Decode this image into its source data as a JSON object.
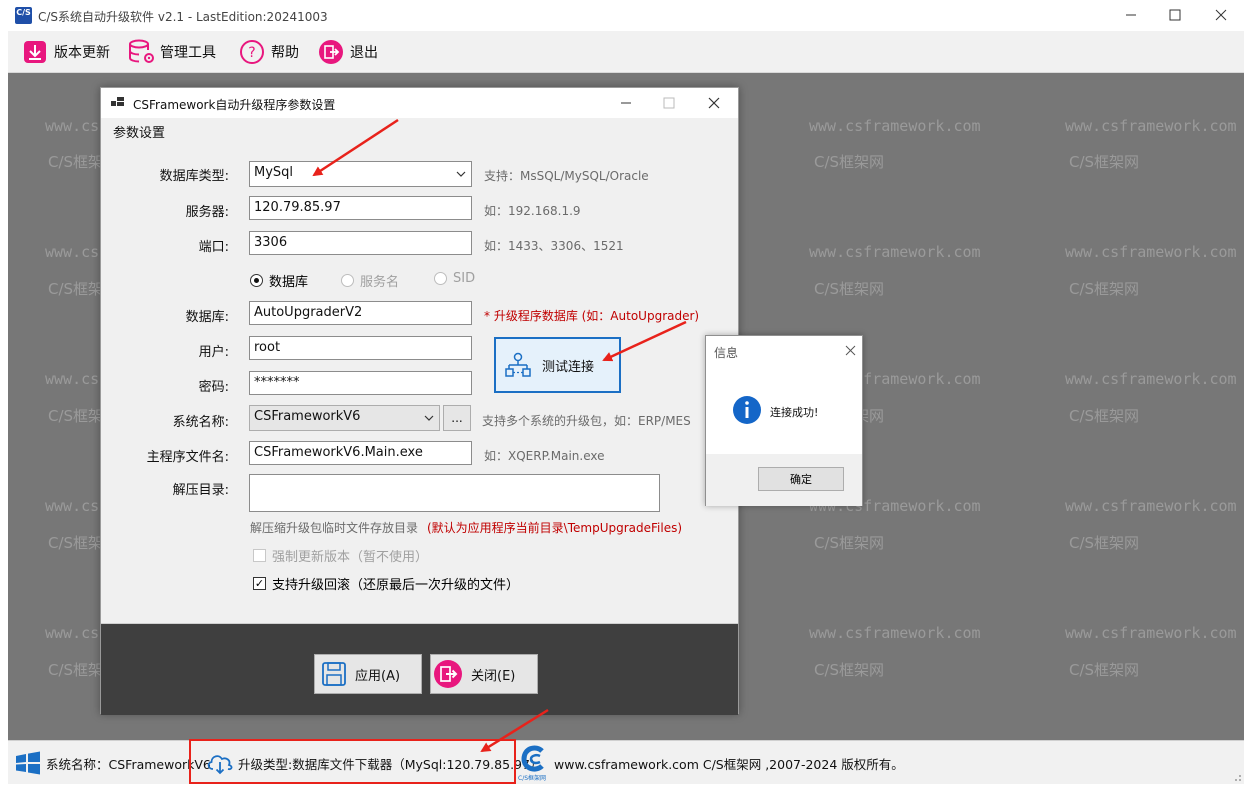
{
  "window": {
    "logo": "C/S",
    "title": "C/S系统自动升级软件 v2.1 - LastEdition:20241003"
  },
  "toolbar": {
    "items": [
      {
        "label": "版本更新",
        "icon": "download-box-icon"
      },
      {
        "label": "管理工具",
        "icon": "database-gear-icon"
      },
      {
        "label": "帮助",
        "icon": "help-circle-icon"
      },
      {
        "label": "退出",
        "icon": "exit-icon"
      }
    ]
  },
  "watermark": {
    "site": "www.csframework.com",
    "brand": "C/S框架网"
  },
  "dialog": {
    "title": "CSFramework自动升级程序参数设置",
    "group_title": "参数设置",
    "labels": {
      "db_type": "数据库类型:",
      "server": "服务器:",
      "port": "端口:",
      "database": "数据库:",
      "user": "用户:",
      "password": "密码:",
      "system_name": "系统名称:",
      "main_exe": "主程序文件名:",
      "extract_dir": "解压目录:"
    },
    "values": {
      "db_type": "MySql",
      "server": "120.79.85.97",
      "port": "3306",
      "database": "AutoUpgraderV2",
      "user": "root",
      "password": "*******",
      "system_name": "CSFrameworkV6",
      "main_exe": "CSFrameworkV6.Main.exe",
      "extract_dir": ""
    },
    "hints": {
      "db_type": "支持：MsSQL/MySQL/Oracle",
      "server": "如：192.168.1.9",
      "port": "如：1433、3306、1521",
      "database": "* 升级程序数据库 (如：AutoUpgrader)",
      "system_name": "支持多个系统的升级包，如：ERP/MES",
      "main_exe": "如：XQERP.Main.exe",
      "extract_dir": "解压缩升级包临时文件存放目录",
      "extract_dir_red": "(默认为应用程序当前目录\\TempUpgradeFiles)"
    },
    "radios": [
      {
        "label": "数据库",
        "checked": true,
        "enabled": true
      },
      {
        "label": "服务名",
        "checked": false,
        "enabled": false
      },
      {
        "label": "SID",
        "checked": false,
        "enabled": false
      }
    ],
    "test_button": "测试连接",
    "browse_button": "...",
    "checkboxes": [
      {
        "label": "强制更新版本（暂不使用）",
        "checked": false,
        "enabled": false
      },
      {
        "label": "支持升级回滚（还原最后一次升级的文件）",
        "checked": true,
        "enabled": true
      }
    ],
    "apply_button": "应用(A)",
    "close_button": "关闭(E)"
  },
  "msgbox": {
    "title": "信息",
    "message": "连接成功!",
    "ok": "确定"
  },
  "statusbar": {
    "system": "系统名称：CSFrameworkV6",
    "upgrade": "升级类型:数据库文件下载器（MySql:120.79.85.97）",
    "logo_caption": "C/S框架网",
    "copyright": "www.csframework.com C/S框架网 ,2007-2024 版权所有。"
  },
  "colors": {
    "accent_pink": "#e8177e",
    "accent_blue": "#1b6fc4",
    "annotation_red": "#e8221b"
  }
}
